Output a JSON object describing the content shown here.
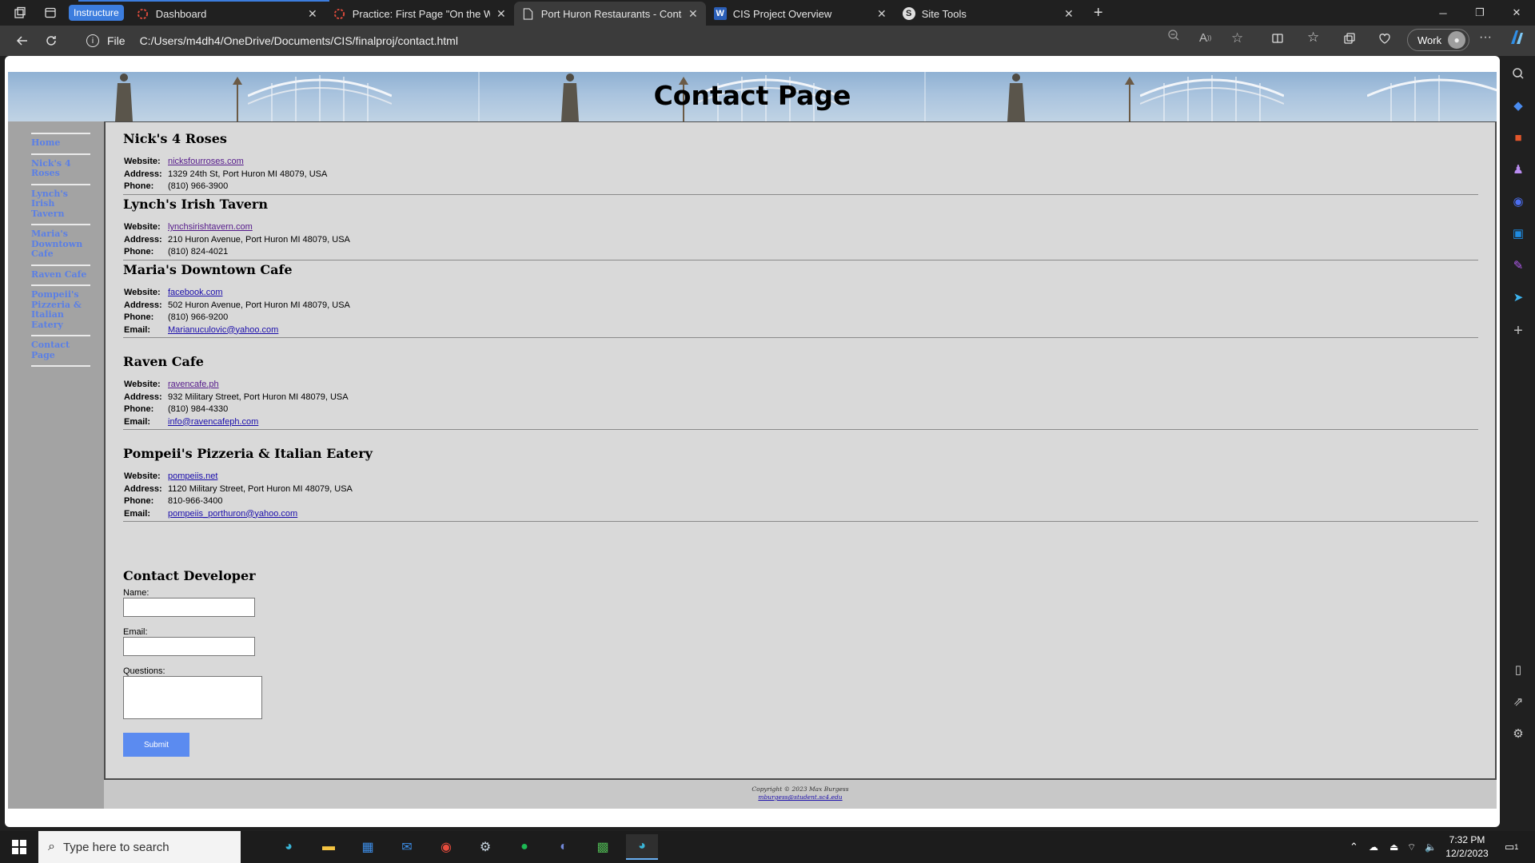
{
  "browser": {
    "tab_group_label": "Instructure",
    "tabs": [
      {
        "title": "Dashboard"
      },
      {
        "title": "Practice: First Page \"On the Web\""
      },
      {
        "title": "Port Huron Restaurants - Contact"
      },
      {
        "title": "CIS Project Overview"
      },
      {
        "title": "Site Tools"
      }
    ],
    "address_scheme": "File",
    "address_url": "C:/Users/m4dh4/OneDrive/Documents/CIS/finalproj/contact.html",
    "profile_label": "Work"
  },
  "page": {
    "banner_title": "Contact Page",
    "nav": [
      "Home",
      "Nick's 4 Roses",
      "Lynch's Irish Tavern",
      "Maria's Downtown Cafe",
      "Raven Cafe",
      "Pompeii's Pizzeria & Italian Eatery",
      "Contact Page"
    ],
    "labels": {
      "website": "Website:",
      "address": "Address:",
      "phone": "Phone:",
      "email": "Email:"
    },
    "restaurants": [
      {
        "name": "Nick's 4 Roses",
        "website": "nicksfourroses.com",
        "address": "1329 24th St, Port Huron MI 48079, USA",
        "phone": "(810) 966-3900"
      },
      {
        "name": "Lynch's Irish Tavern",
        "website": "lynchsirishtavern.com",
        "address": "210 Huron Avenue, Port Huron MI 48079, USA",
        "phone": "(810) 824-4021"
      },
      {
        "name": "Maria's Downtown Cafe",
        "website": "facebook.com",
        "address": "502 Huron Avenue, Port Huron MI 48079, USA",
        "phone": "(810) 966-9200",
        "email": "Marianuculovic@yahoo.com"
      },
      {
        "name": "Raven Cafe",
        "website": "ravencafe.ph",
        "address": "932 Military Street, Port Huron MI 48079, USA",
        "phone": "(810) 984-4330",
        "email": "info@ravencafeph.com"
      },
      {
        "name": "Pompeii's Pizzeria & Italian Eatery",
        "website": "pompeiis.net",
        "address": "1120 Military Street, Port Huron MI 48079, USA",
        "phone": "810-966-3400",
        "email": "pompeiis_porthuron@yahoo.com"
      }
    ],
    "form": {
      "heading": "Contact Developer",
      "name_label": "Name:",
      "email_label": "Email:",
      "questions_label": "Questions:",
      "submit_label": "Submit"
    },
    "footer": {
      "copyright": "Copyright © 2023 Max Burgess",
      "email": "mburgess@student.sc4.edu"
    }
  },
  "taskbar": {
    "search_placeholder": "Type here to search",
    "time": "7:32 PM",
    "date": "12/2/2023",
    "notification_count": "1"
  },
  "colors": {
    "nav_link": "#5a7fe6",
    "submit_button": "#5b8bf0",
    "tab_group_accent": "#3c7dde",
    "content_bg": "#d9d9d9",
    "sidebar_bg": "#a3a3a3"
  },
  "icons": {
    "tab_strip": [
      "workspaces-icon",
      "tab-actions-icon"
    ],
    "toolbar": [
      "back-icon",
      "refresh-icon",
      "site-info-icon",
      "zoom-icon",
      "read-aloud-icon",
      "favorite-star-icon",
      "split-screen-icon",
      "favorites-icon",
      "collections-icon",
      "browser-essentials-icon",
      "more-icon",
      "copilot-icon"
    ],
    "edge_sidebar": [
      "search-icon",
      "shopping-tag-icon",
      "tools-icon",
      "games-icon",
      "microsoft-365-icon",
      "outlook-icon",
      "designer-icon",
      "send-icon",
      "add-icon",
      "sidebar-layout-icon",
      "open-external-icon",
      "settings-icon"
    ],
    "taskbar": [
      "windows-start-icon",
      "edge-icon",
      "file-explorer-icon",
      "store-icon",
      "mail-icon",
      "chrome-icon",
      "steam-icon",
      "spotify-icon",
      "discord-icon",
      "minecraft-icon",
      "edge-active-icon"
    ]
  }
}
